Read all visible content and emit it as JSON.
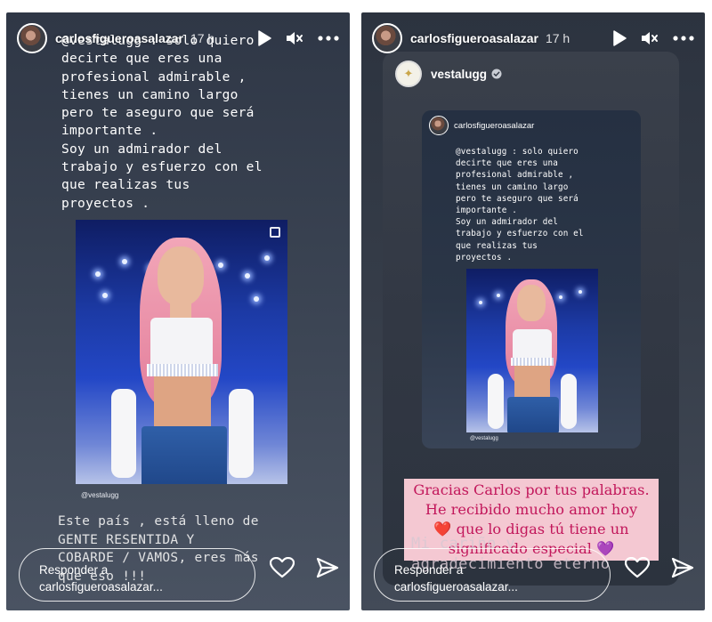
{
  "left_story": {
    "username": "carlosfigueroasalazar",
    "time": "17 h",
    "message": "@vestalugg : solo quiero\ndecirte que eres una\nprofesional admirable ,\ntienes un camino largo\npero te aseguro que será\nimportante .\nSoy un admirador del\ntrabajo y esfuerzo con el\nque realizas tus\nproyectos .",
    "photo_credit": "@vestalugg",
    "bottom_text": "Este país , está lleno de\nGENTE RESENTIDA Y\nCOBARDE / VAMOS, eres más\nque eso !!!",
    "reply_placeholder_line1": "Responder a",
    "reply_placeholder_line2": "carlosfigueroasalazar..."
  },
  "right_story": {
    "username": "carlosfigueroasalazar",
    "time": "17 h",
    "shared_account": "vestalugg",
    "inner_username": "carlosfigueroasalazar",
    "inner_message": "@vestalugg : solo quiero\ndecirte que eres una\nprofesional admirable ,\ntienes un camino largo\npero te aseguro que será\nimportante .\nSoy un admirador del\ntrabajo y esfuerzo con el\nque realizas tus\nproyectos .",
    "inner_credit": "@vestalugg",
    "reply_line1": "Gracias Carlos por tus palabras.",
    "reply_line2": "He recibido mucho amor hoy",
    "reply_line3_heart": "❤️",
    "reply_line3_text": " que lo digas tú tiene un",
    "reply_line4_text": "significado especial ",
    "reply_line4_heart": "💜",
    "bottom_text": "Mi cariño y\nagradecimiento eterno",
    "reply_placeholder_line1": "Responder a",
    "reply_placeholder_line2": "carlosfigueroasalazar..."
  },
  "icons": {
    "play": "play-icon",
    "mute": "mute-icon",
    "more": "more-icon",
    "heart": "heart-icon",
    "send": "send-icon",
    "verified": "verified-badge-icon"
  },
  "colors": {
    "reply_box_bg": "#f4c8d2",
    "reply_text": "#c2175b",
    "verified": "#3897f0"
  }
}
